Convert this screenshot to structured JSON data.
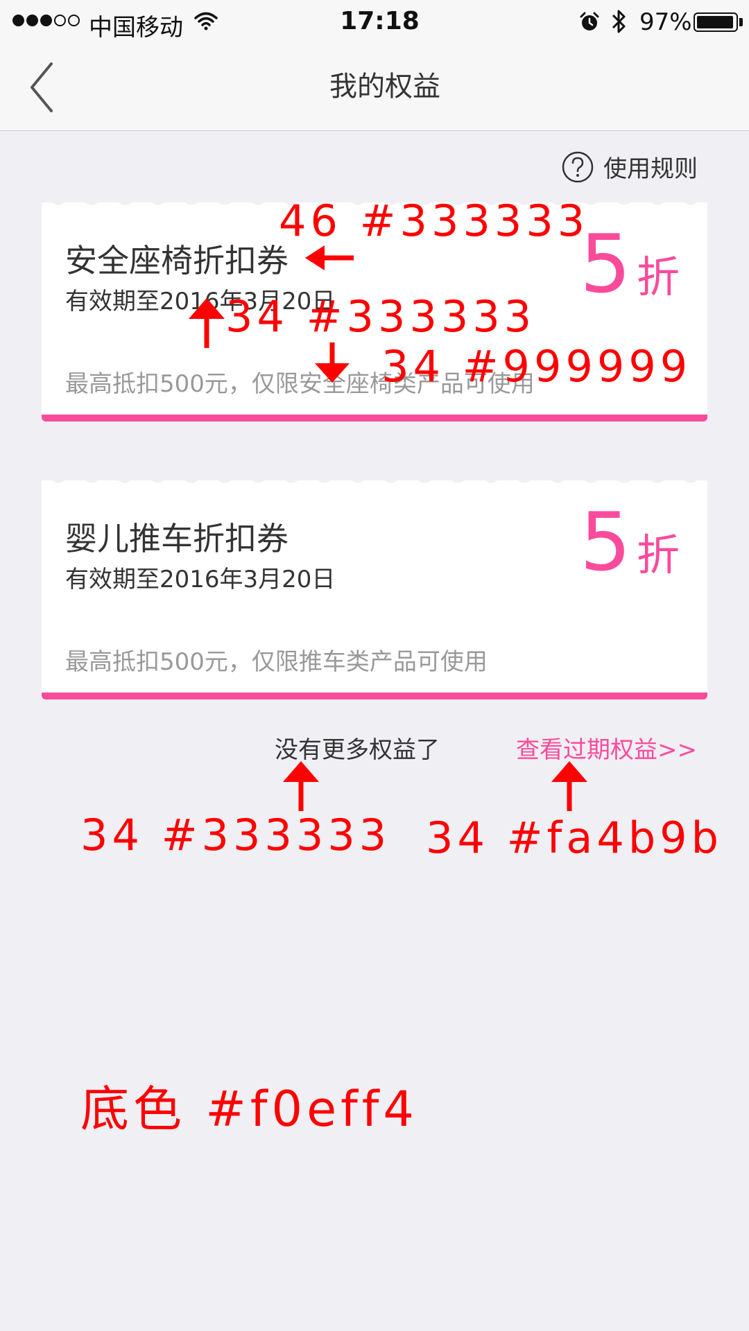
{
  "status_bar": {
    "carrier": "中国移动",
    "time": "17:18",
    "battery": "97%",
    "battery_level": 0.97,
    "icons": [
      "signal-dots-icon",
      "wifi-icon",
      "alarm-icon",
      "bluetooth-icon",
      "battery-icon"
    ]
  },
  "nav": {
    "title": "我的权益",
    "back_icon": "chevron-left-icon"
  },
  "rules": {
    "label": "使用规则",
    "icon": "help-circle-icon"
  },
  "coupons": [
    {
      "name": "安全座椅折扣券",
      "validity": "有效期至2016年3月20日",
      "discount_value": "5",
      "discount_unit": "折",
      "description": "最高抵扣500元，仅限安全座椅类产品可使用"
    },
    {
      "name": "婴儿推车折扣券",
      "validity": "有效期至2016年3月20日",
      "discount_value": "5",
      "discount_unit": "折",
      "description": "最高抵扣500元，仅限推车类产品可使用"
    }
  ],
  "footer": {
    "no_more": "没有更多权益了",
    "view_expired": "查看过期权益>>"
  },
  "annotations": {
    "title_spec": "46 #333333",
    "validity_spec": "34 #333333",
    "desc_spec": "34 #999999",
    "no_more_spec": "34 #333333",
    "expired_spec": "34 #fa4b9b",
    "background_spec": "底色 #f0eff4"
  },
  "colors": {
    "background": "#f0eff4",
    "accent": "#fa4b9b",
    "primary_text": "#333333",
    "secondary_text": "#999999",
    "annotation": "#ff0000"
  }
}
